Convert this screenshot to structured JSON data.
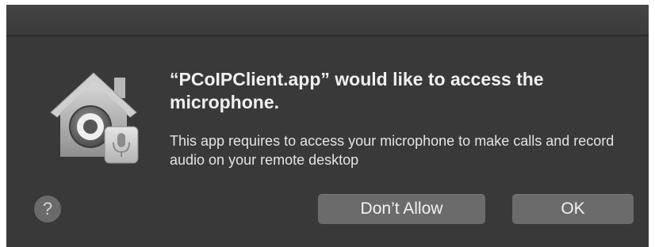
{
  "dialog": {
    "heading": "“PCoIPClient.app” would like to access the microphone.",
    "message": "This app requires to access your microphone to make calls and record audio on your remote desktop",
    "help_label": "?",
    "deny_label": "Don’t Allow",
    "ok_label": "OK",
    "icon": "house-lock-microphone-icon"
  },
  "colors": {
    "dialog_background": "#393939",
    "button_background": "#6b6b6b",
    "text": "#f0f0f0"
  }
}
